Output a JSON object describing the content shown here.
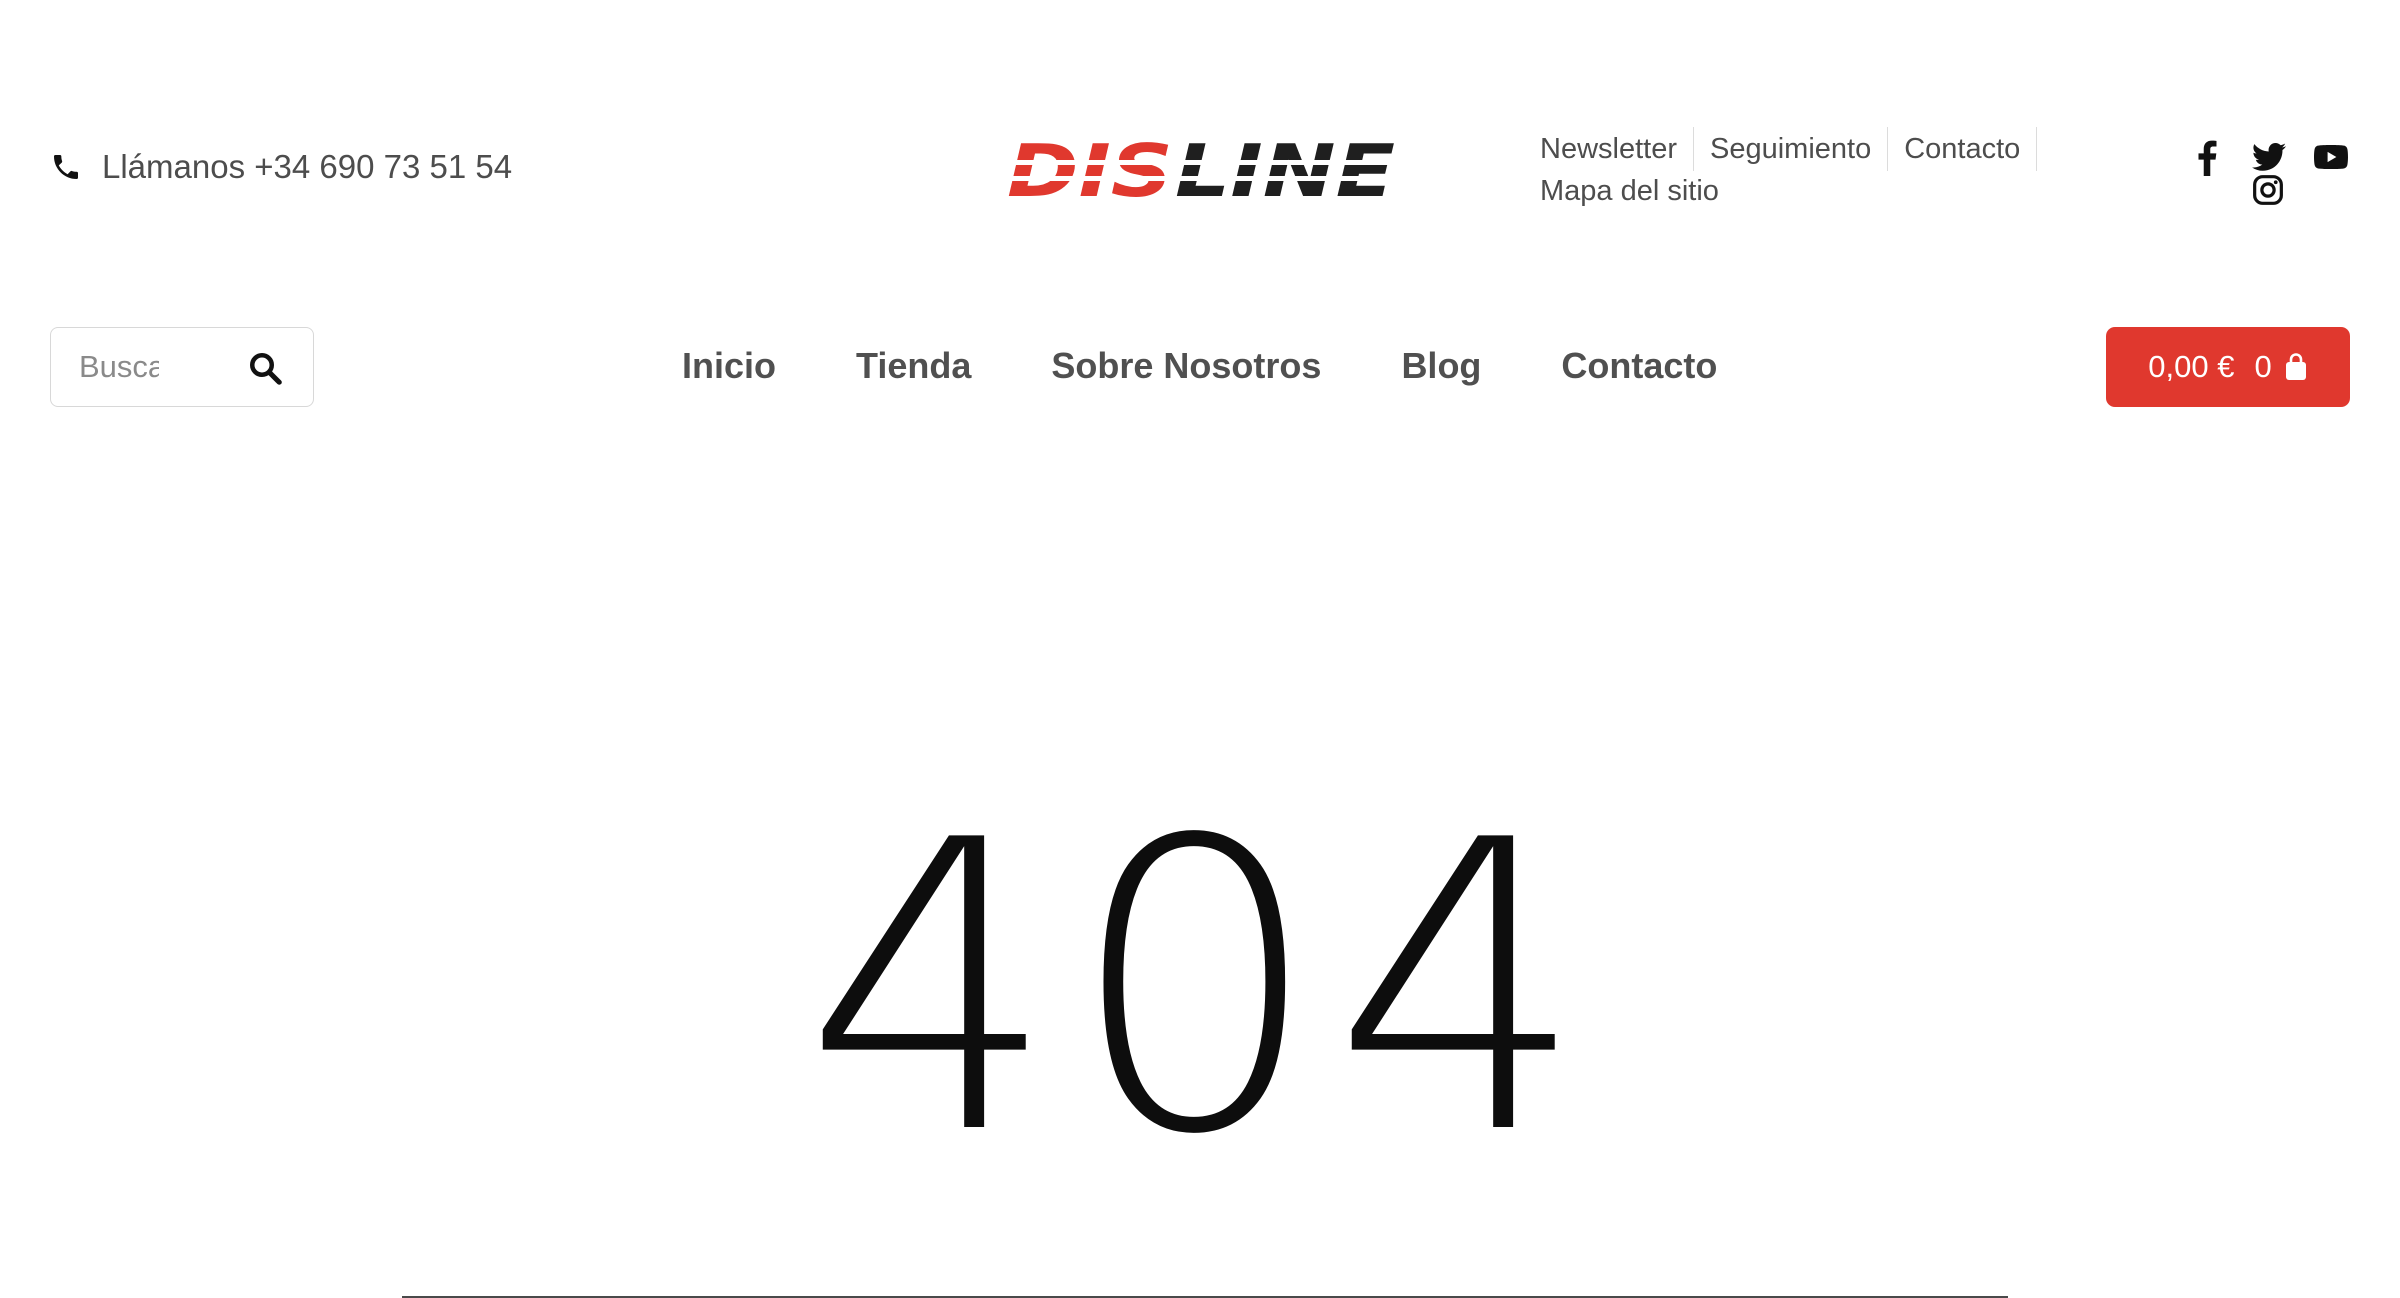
{
  "header": {
    "phone_text": "Llámanos +34 690 73 51 54",
    "logo": {
      "brand": "DISLINE",
      "red_part": "DIS",
      "dark_part": "LINE"
    },
    "top_links": [
      "Newsletter",
      "Seguimiento",
      "Contacto",
      "Mapa del sitio"
    ],
    "social_icons": [
      "facebook-icon",
      "twitter-icon",
      "youtube-icon",
      "instagram-icon"
    ]
  },
  "search": {
    "placeholder": "Buscar",
    "icon": "search-icon"
  },
  "nav": {
    "items": [
      "Inicio",
      "Tienda",
      "Sobre Nosotros",
      "Blog",
      "Contacto"
    ]
  },
  "cart": {
    "total": "0,00 €",
    "count": "0",
    "icon": "shopping-bag-icon"
  },
  "error": {
    "code": "404"
  },
  "colors": {
    "brand_red": "#e0382e",
    "logo_dark": "#1f1f1f",
    "text": "#4d4d4d"
  }
}
